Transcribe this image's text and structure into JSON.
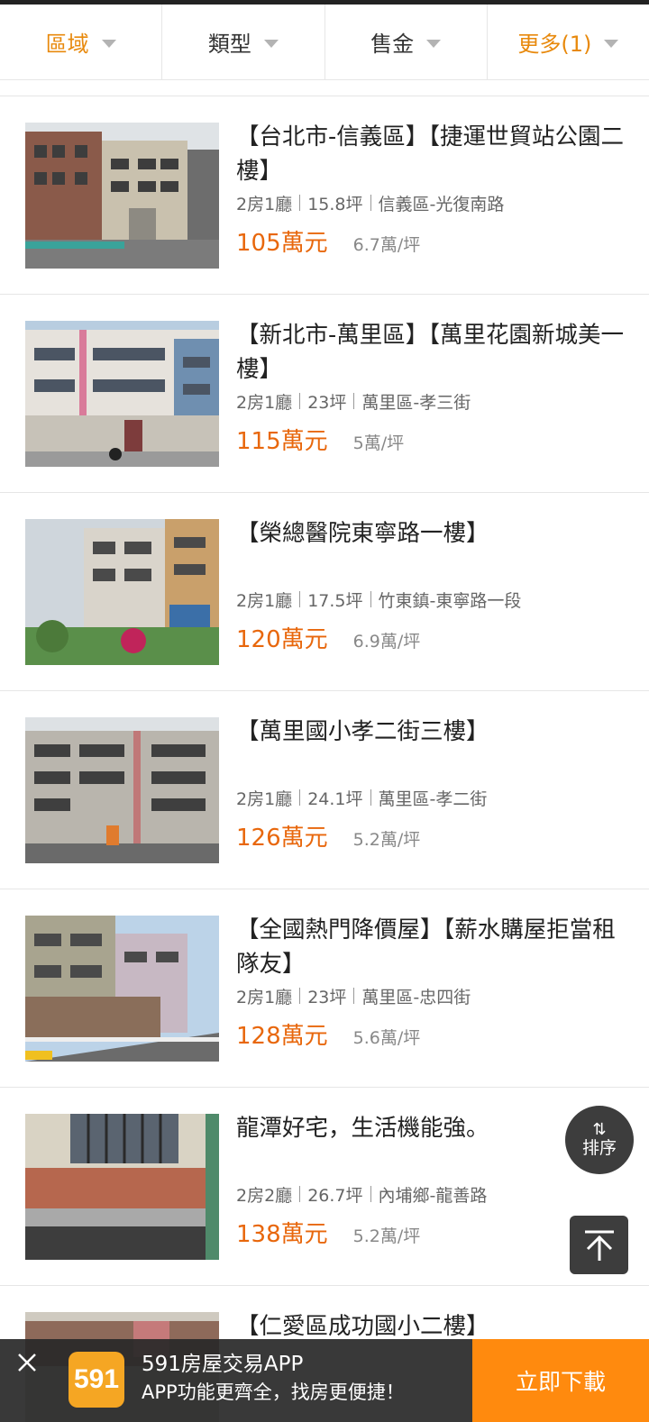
{
  "filters": [
    {
      "label": "區域",
      "active": true
    },
    {
      "label": "類型",
      "active": false
    },
    {
      "label": "售金",
      "active": false
    },
    {
      "label": "更多(1)",
      "active": true
    }
  ],
  "listings": [
    {
      "title": "【台北市-信義區】【捷運世貿站公園二樓】",
      "layout": "2房1廳",
      "size": "15.8坪",
      "location": "信義區-光復南路",
      "price": "105萬元",
      "unit_price": "6.7萬/坪"
    },
    {
      "title": "【新北市-萬里區】【萬里花園新城美一樓】",
      "layout": "2房1廳",
      "size": "23坪",
      "location": "萬里區-孝三街",
      "price": "115萬元",
      "unit_price": "5萬/坪"
    },
    {
      "title": "【榮總醫院東寧路一樓】",
      "layout": "2房1廳",
      "size": "17.5坪",
      "location": "竹東鎮-東寧路一段",
      "price": "120萬元",
      "unit_price": "6.9萬/坪"
    },
    {
      "title": "【萬里國小孝二街三樓】",
      "layout": "2房1廳",
      "size": "24.1坪",
      "location": "萬里區-孝二街",
      "price": "126萬元",
      "unit_price": "5.2萬/坪"
    },
    {
      "title": "【全國熱門降價屋】【薪水購屋拒當租隊友】",
      "layout": "2房1廳",
      "size": "23坪",
      "location": "萬里區-忠四街",
      "price": "128萬元",
      "unit_price": "5.6萬/坪"
    },
    {
      "title": "龍潭好宅，生活機能強。",
      "layout": "2房2廳",
      "size": "26.7坪",
      "location": "內埔鄉-龍善路",
      "price": "138萬元",
      "unit_price": "5.2萬/坪"
    },
    {
      "title": "【仁愛區成功國小二樓】",
      "layout": "",
      "size": "",
      "location": "",
      "price": "",
      "unit_price": ""
    }
  ],
  "sort_button": {
    "label": "排序",
    "icon": "sort-arrows-icon"
  },
  "back_to_top": {
    "icon": "arrow-up-icon"
  },
  "app_banner": {
    "logo_text": "591",
    "title": "591房屋交易APP",
    "subtitle": "APP功能更齊全，找房更便捷！",
    "download_label": "立即下載"
  },
  "colors": {
    "accent": "#e8670c",
    "filter_active": "#e8890c",
    "download_bg": "#ff8a0e"
  }
}
